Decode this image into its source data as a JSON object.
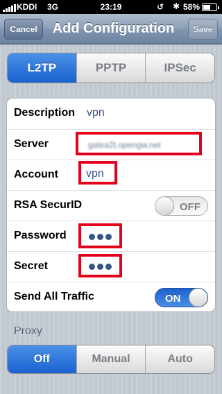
{
  "status_bar": {
    "carrier": "KDDI",
    "network": "3G",
    "time": "23:19",
    "battery_percent_label": "58%",
    "battery_level": 0.58,
    "icons": [
      "signal-icon",
      "lock-rotation-icon",
      "bluetooth-icon",
      "battery-icon"
    ]
  },
  "nav": {
    "title": "Add Configuration",
    "cancel_label": "Cancel",
    "save_label": "Save"
  },
  "vpn_type": {
    "options": [
      "L2TP",
      "PPTP",
      "IPSec"
    ],
    "selected": "L2TP"
  },
  "form": {
    "description": {
      "label": "Description",
      "value": "vpn"
    },
    "server": {
      "label": "Server",
      "value": "gatea2t.opengw.net"
    },
    "account": {
      "label": "Account",
      "value": "vpn"
    },
    "rsa_securid": {
      "label": "RSA SecurID",
      "state": "OFF"
    },
    "password": {
      "label": "Password",
      "value": "•••"
    },
    "secret": {
      "label": "Secret",
      "value": "•••"
    },
    "send_all_traffic": {
      "label": "Send All Traffic",
      "state": "ON"
    }
  },
  "proxy": {
    "section_label": "Proxy",
    "options": [
      "Off",
      "Manual",
      "Auto"
    ],
    "selected": "Off"
  },
  "colors": {
    "selected_segment": "#1a62d1",
    "highlight_box": "#e4001b",
    "value_text": "#385487",
    "background": "#c5ccd4"
  }
}
